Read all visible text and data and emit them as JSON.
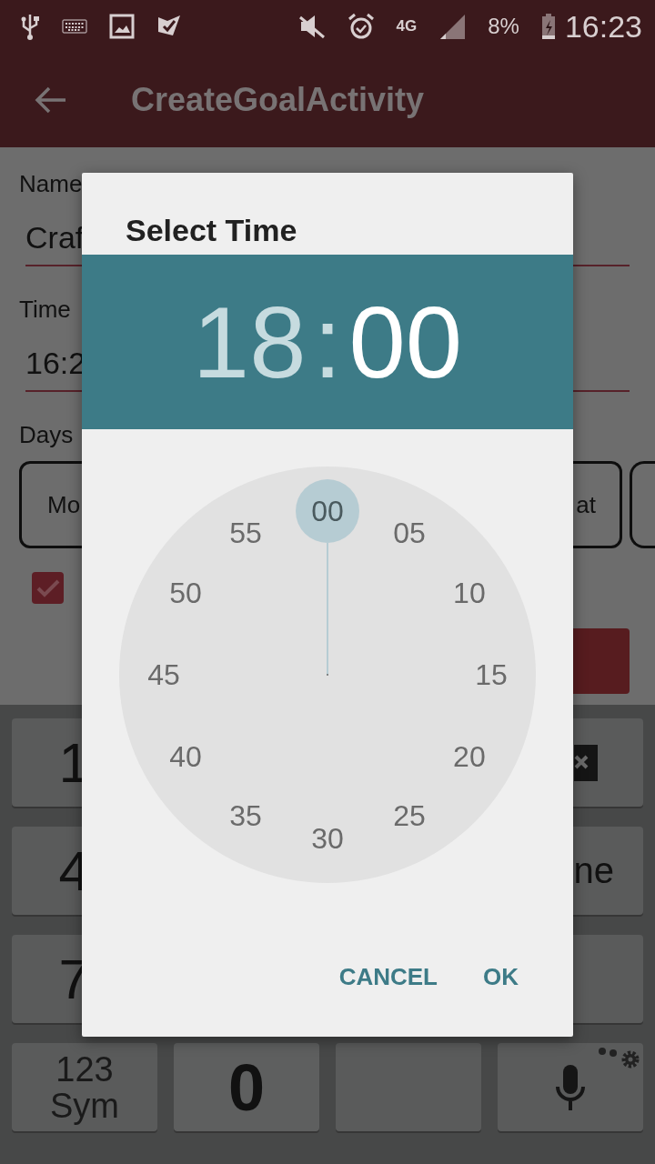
{
  "status_bar": {
    "network": "4G",
    "battery": "8%",
    "time": "16:23"
  },
  "app_bar": {
    "title": "CreateGoalActivity"
  },
  "form": {
    "name_label": "Name",
    "name_value": "Craf",
    "time_label": "Time",
    "time_value": "16:2",
    "days_label": "Days",
    "days": [
      {
        "label": "Mo",
        "kind": "start",
        "selected": false
      },
      {
        "label": "at",
        "kind": "end",
        "selected": false
      },
      {
        "kind": "edge",
        "selected": false
      }
    ],
    "reminder": {
      "checked": true
    }
  },
  "keyboard": {
    "rows": [
      [
        {
          "label": "1",
          "kind": "digit"
        },
        {
          "kind": "backspace"
        }
      ],
      [
        {
          "label": "4",
          "kind": "digit"
        },
        {
          "label": "ne",
          "kind": "action"
        }
      ],
      [
        {
          "label": "7",
          "kind": "digit"
        },
        {
          "kind": "blank"
        }
      ],
      [
        {
          "label": "123",
          "sub": "Sym",
          "kind": "mode"
        },
        {
          "label": "0",
          "kind": "zero"
        },
        {
          "kind": "space"
        },
        {
          "kind": "mic"
        }
      ]
    ]
  },
  "dialog": {
    "title": "Select Time",
    "hour": {
      "text": "18",
      "selected": false
    },
    "separator": ":",
    "minute": {
      "text": "00",
      "selected": true
    },
    "dial": [
      {
        "label": "00",
        "selected": true
      },
      {
        "label": "05",
        "selected": false
      },
      {
        "label": "10",
        "selected": false
      },
      {
        "label": "15",
        "selected": false
      },
      {
        "label": "20",
        "selected": false
      },
      {
        "label": "25",
        "selected": false
      },
      {
        "label": "30",
        "selected": false
      },
      {
        "label": "35",
        "selected": false
      },
      {
        "label": "40",
        "selected": false
      },
      {
        "label": "45",
        "selected": false
      },
      {
        "label": "50",
        "selected": false
      },
      {
        "label": "55",
        "selected": false
      }
    ],
    "buttons": [
      "CANCEL",
      "OK"
    ]
  }
}
